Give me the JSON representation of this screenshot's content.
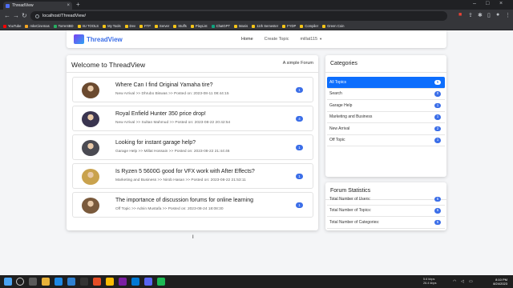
{
  "browser": {
    "tab_title": "ThreadView",
    "url": "localhost/ThreadView/",
    "bookmarks": [
      {
        "label": "YouTube",
        "color": "#ff0000"
      },
      {
        "label": "mkvCinemas",
        "color": "#f5a623"
      },
      {
        "label": "TorrentBD",
        "color": "#27ae60"
      },
      {
        "label": "IIU TOOLS",
        "color": "#f5c518"
      },
      {
        "label": "My Tools",
        "color": "#f5c518"
      },
      {
        "label": "Dev",
        "color": "#f5c518"
      },
      {
        "label": "FTP",
        "color": "#f5c518"
      },
      {
        "label": "Server",
        "color": "#f5c518"
      },
      {
        "label": "Stuffs",
        "color": "#f5c518"
      },
      {
        "label": "PlayList",
        "color": "#f5c518"
      },
      {
        "label": "ChatGPT",
        "color": "#10a37f"
      },
      {
        "label": "Manis",
        "color": "#f5c518"
      },
      {
        "label": "11th Semester",
        "color": "#f5c518"
      },
      {
        "label": "FYDP",
        "color": "#f5c518"
      },
      {
        "label": "Compiler",
        "color": "#f5c518"
      },
      {
        "label": "Green Coin",
        "color": "#f5c518"
      }
    ]
  },
  "navbar": {
    "brand": "ThreadView",
    "links": [
      "Home",
      "Create Topic",
      "millat115"
    ]
  },
  "main": {
    "title": "Welcome to ThreadView",
    "subtitle": "A simple Forum",
    "topics": [
      {
        "title": "Where Can I find Original Yamaha tire?",
        "meta": "New Arrival >> Dhrubo Biswas >> Posted on: 2023-08-11 08:44:15",
        "badge": "1",
        "avatar": "#6b4a2f"
      },
      {
        "title": "Royal Enfield Hunter 350 price drop!",
        "meta": "New Arrival >> Sultan Mahmud >> Posted on: 2023-08-22 20:42:54",
        "badge": "4",
        "avatar": "#3a3550"
      },
      {
        "title": "Looking for instant garage help?",
        "meta": "Garage Help >> Millat Hossain >> Posted on: 2023-08-22 21:44:46",
        "badge": "1",
        "avatar": "#4a4a52"
      },
      {
        "title": "Is Ryzen 5 5600G good for VFX work with After Effects?",
        "meta": "Marketing and Business >> Nirob Hasan >> Posted on: 2023-08-22 21:53:11",
        "badge": "1",
        "avatar": "#c9a24d"
      },
      {
        "title": "The importance of discussion forums for online learning",
        "meta": "Off Topic >> Adnin Mustafa >> Posted on: 2023-08-24 18:08:30",
        "badge": "1",
        "avatar": "#7a5a3c"
      }
    ]
  },
  "categories": {
    "title": "Categories",
    "items": [
      {
        "label": "All Topics",
        "badge": "5"
      },
      {
        "label": "Search",
        "badge": "0"
      },
      {
        "label": "Garage Help",
        "badge": "1"
      },
      {
        "label": "Marketing and Business",
        "badge": "1"
      },
      {
        "label": "New Arrival",
        "badge": "2"
      },
      {
        "label": "Off Topic",
        "badge": "1"
      }
    ]
  },
  "stats": {
    "title": "Forum Statistics",
    "items": [
      {
        "label": "Total Number of Users:",
        "badge": "5"
      },
      {
        "label": "Total Number of Topics:",
        "badge": "5"
      },
      {
        "label": "Total Number of Categories:",
        "badge": "5"
      }
    ]
  },
  "taskbar": {
    "net_up": "5.6 kbps",
    "net_down": "26.4 kbps",
    "time": "8:10 PM",
    "date": "8/24/2023"
  }
}
